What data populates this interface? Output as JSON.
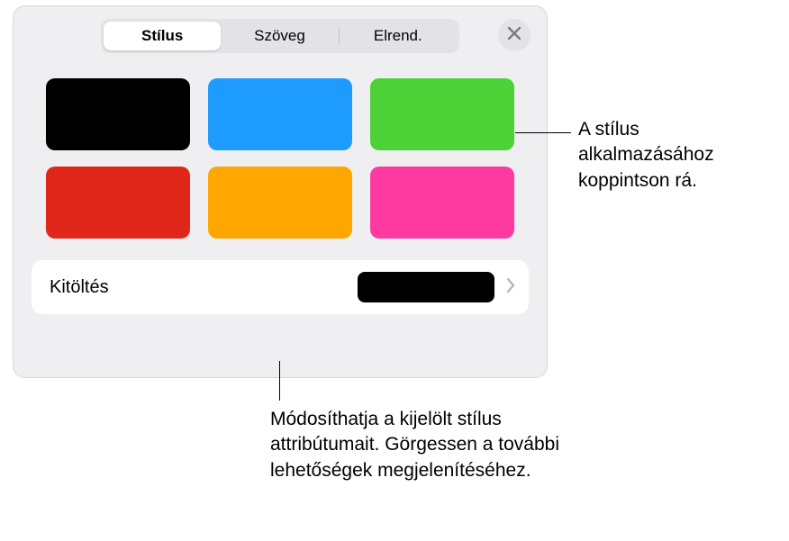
{
  "tabs": {
    "style": "Stílus",
    "text": "Szöveg",
    "arrange": "Elrend."
  },
  "swatches": [
    {
      "name": "black",
      "color": "#000000"
    },
    {
      "name": "blue",
      "color": "#1e9bff"
    },
    {
      "name": "green",
      "color": "#4cd237"
    },
    {
      "name": "red",
      "color": "#e1261a"
    },
    {
      "name": "orange",
      "color": "#ffa600"
    },
    {
      "name": "pink",
      "color": "#fd3aa0"
    }
  ],
  "fill": {
    "label": "Kitöltés",
    "preview_color": "#000000"
  },
  "callouts": {
    "apply": "A stílus alkalmazásához koppintson rá.",
    "modify": "Módosíthatja a kijelölt stílus attribútumait. Görgessen a további lehetőségek megjelenítéséhez."
  }
}
